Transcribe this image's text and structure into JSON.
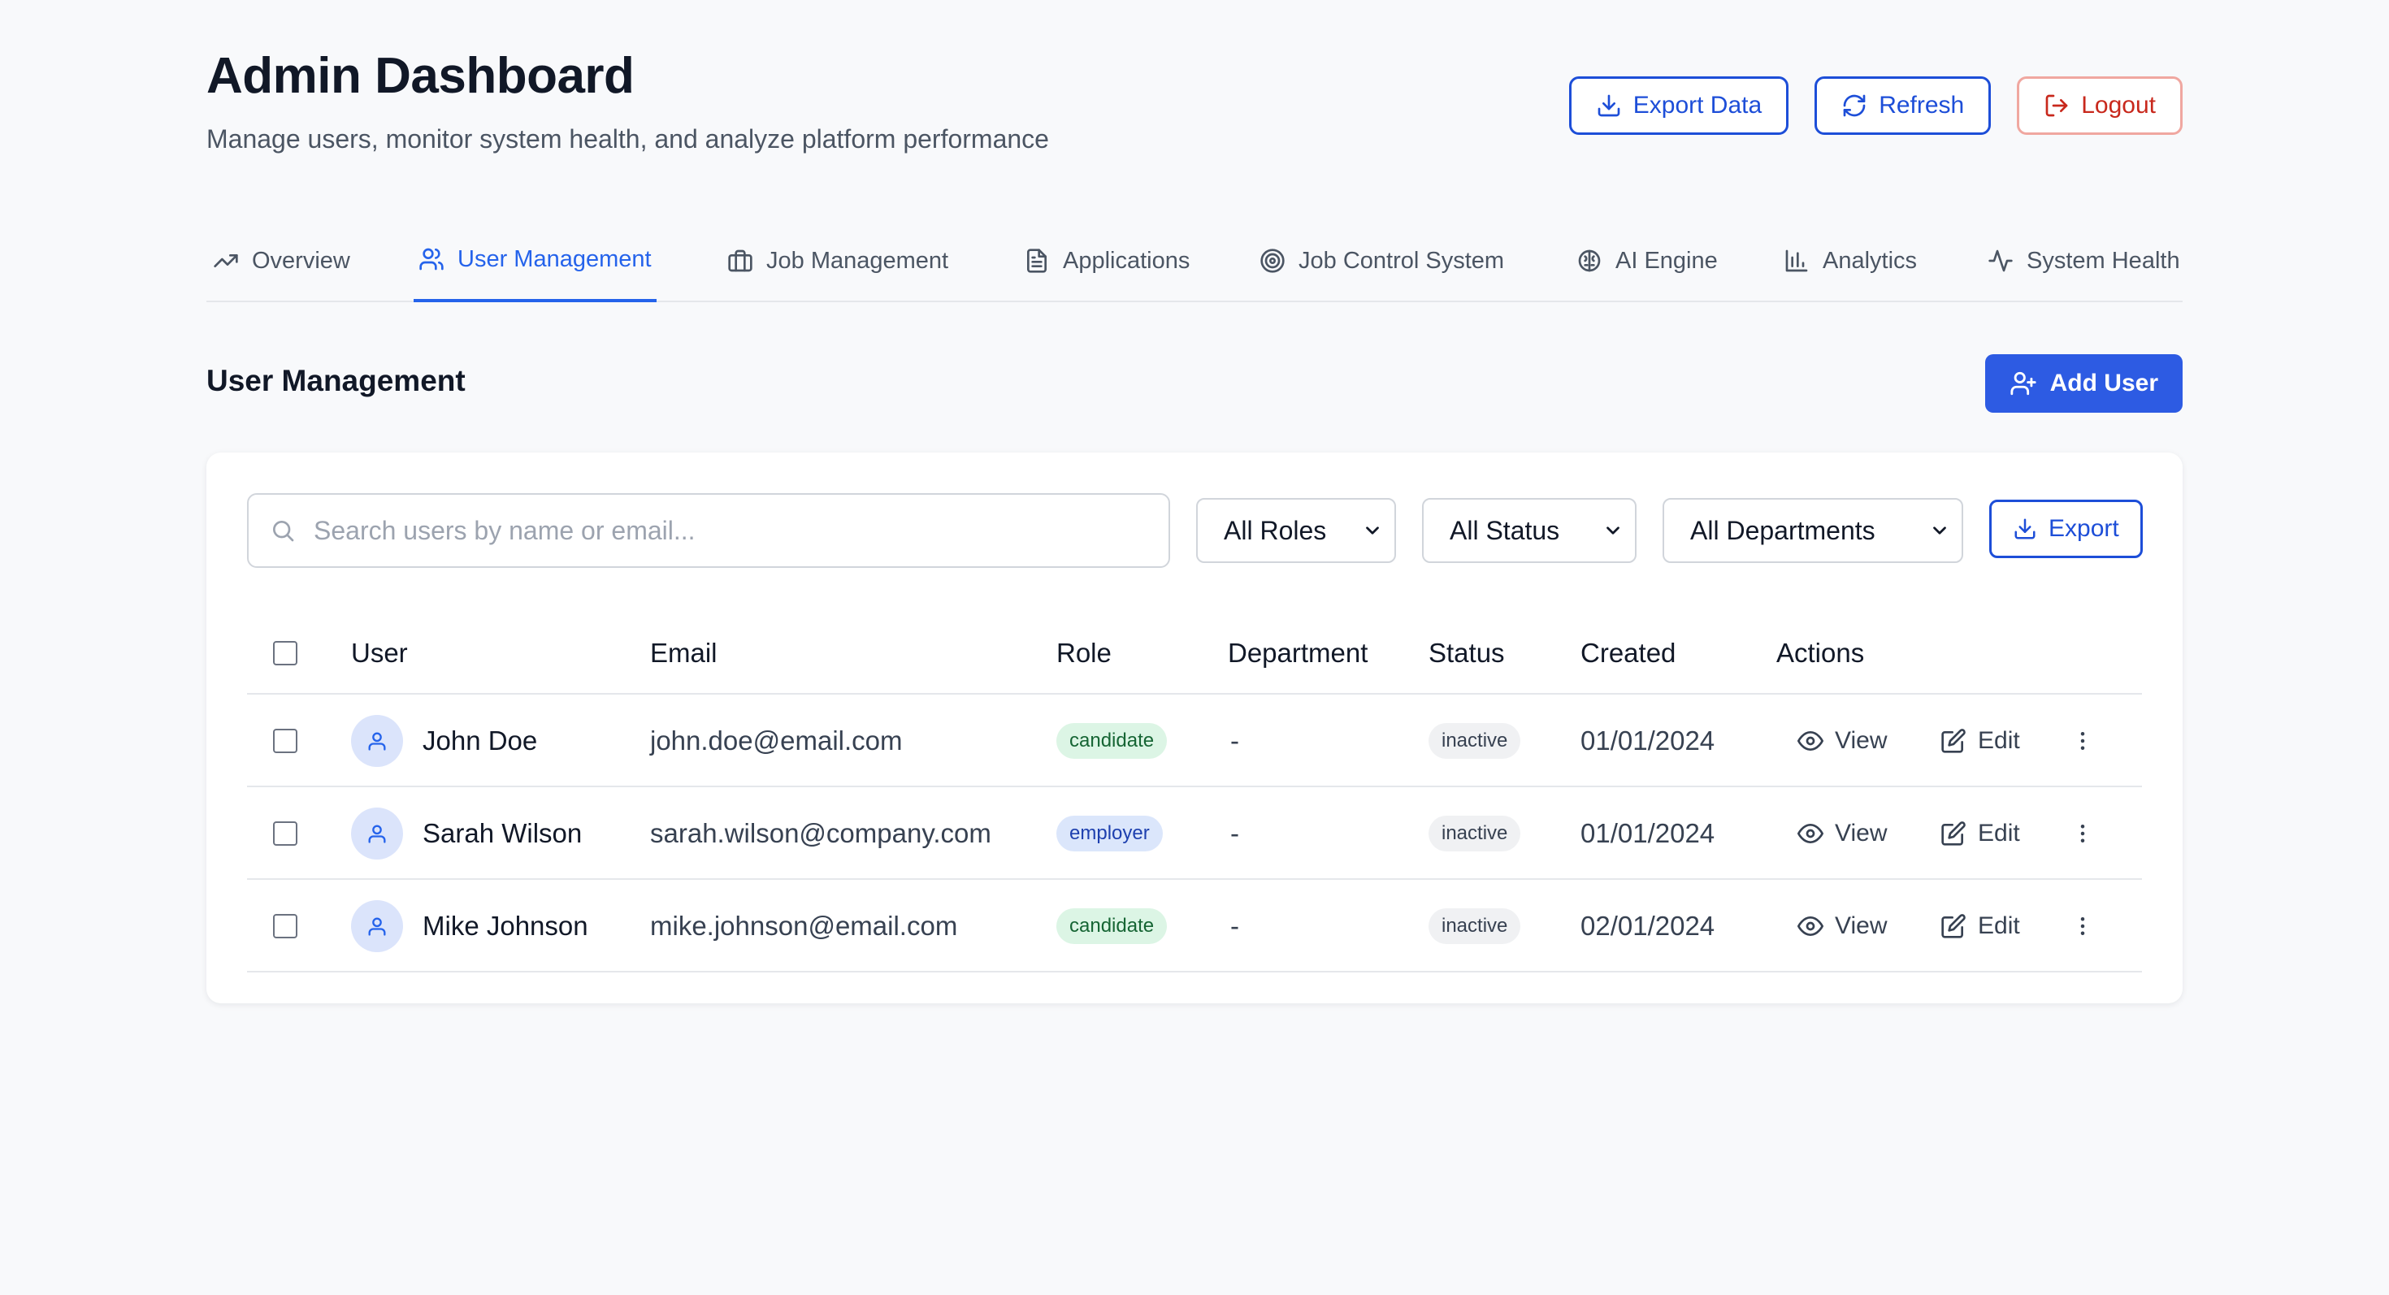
{
  "header": {
    "title": "Admin Dashboard",
    "subtitle": "Manage users, monitor system health, and analyze platform performance",
    "export_label": "Export Data",
    "refresh_label": "Refresh",
    "logout_label": "Logout"
  },
  "tabs": [
    {
      "label": "Overview",
      "icon": "trending-up-icon"
    },
    {
      "label": "User Management",
      "icon": "users-icon",
      "active": true
    },
    {
      "label": "Job Management",
      "icon": "briefcase-icon"
    },
    {
      "label": "Applications",
      "icon": "file-text-icon"
    },
    {
      "label": "Job Control System",
      "icon": "target-icon"
    },
    {
      "label": "AI Engine",
      "icon": "brain-icon"
    },
    {
      "label": "Analytics",
      "icon": "bar-chart-icon"
    },
    {
      "label": "System Health",
      "icon": "activity-icon"
    }
  ],
  "section": {
    "title": "User Management",
    "add_user_label": "Add User"
  },
  "filters": {
    "search_placeholder": "Search users by name or email...",
    "roles": "All Roles",
    "status": "All Status",
    "departments": "All Departments",
    "export_label": "Export"
  },
  "table": {
    "columns": [
      "User",
      "Email",
      "Role",
      "Department",
      "Status",
      "Created",
      "Actions"
    ],
    "view_label": "View",
    "edit_label": "Edit",
    "rows": [
      {
        "name": "John Doe",
        "email": "john.doe@email.com",
        "role": "candidate",
        "department": "-",
        "status": "inactive",
        "created": "01/01/2024"
      },
      {
        "name": "Sarah Wilson",
        "email": "sarah.wilson@company.com",
        "role": "employer",
        "department": "-",
        "status": "inactive",
        "created": "01/01/2024"
      },
      {
        "name": "Mike Johnson",
        "email": "mike.johnson@email.com",
        "role": "candidate",
        "department": "-",
        "status": "inactive",
        "created": "02/01/2024"
      }
    ]
  },
  "colors": {
    "primary": "#2d5be3",
    "accent_blue": "#1d4ed8",
    "danger": "#c8281c",
    "background": "#f8f9fb"
  }
}
